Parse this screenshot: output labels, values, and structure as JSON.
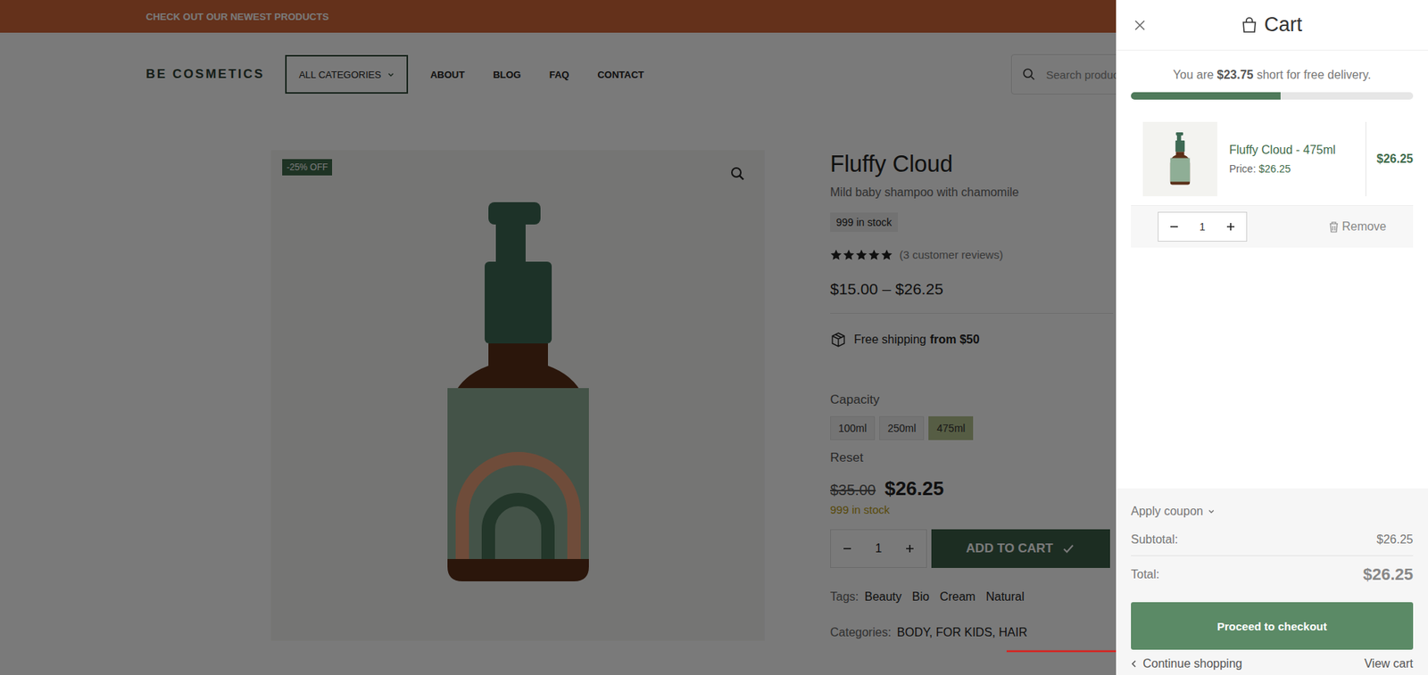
{
  "announcement": "CHECK OUT OUR NEWEST PRODUCTS",
  "header": {
    "logo": "BE COSMETICS",
    "categories_button": "ALL CATEGORIES",
    "nav": [
      "ABOUT",
      "BLOG",
      "FAQ",
      "CONTACT"
    ],
    "search_placeholder": "Search products..."
  },
  "product": {
    "badge": "-25% OFF",
    "title": "Fluffy Cloud",
    "subtitle": "Mild baby shampoo with chamomile",
    "stock_badge": "999 in stock",
    "stars": 5,
    "reviews": "(3 customer reviews)",
    "price_range": "$15.00 – $26.25",
    "shipping_text": "Free shipping",
    "shipping_bold": "from $50",
    "capacity_label": "Capacity",
    "capacities": [
      {
        "label": "100ml",
        "selected": false
      },
      {
        "label": "250ml",
        "selected": false
      },
      {
        "label": "475ml",
        "selected": true
      }
    ],
    "reset": "Reset",
    "old_price": "$35.00",
    "price": "$26.25",
    "stock": "999 in stock",
    "quantity": "1",
    "add_to_cart": "ADD TO CART",
    "tags_label": "Tags:",
    "tags": [
      "Beauty",
      "Bio",
      "Cream",
      "Natural"
    ],
    "categories_label": "Categories:",
    "categories": "BODY, FOR KIDS, HAIR"
  },
  "cart": {
    "title": "Cart",
    "delivery_prefix": "You are ",
    "delivery_amount": "$23.75",
    "delivery_suffix": " short for free delivery.",
    "delivery_level": 0.53,
    "items": [
      {
        "name": "Fluffy Cloud - 475ml",
        "price_label": "Price:",
        "price": "$26.25",
        "total": "$26.25",
        "quantity": "1"
      }
    ],
    "remove": "Remove",
    "coupon": "Apply coupon",
    "subtotal_label": "Subtotal:",
    "subtotal": "$26.25",
    "total_label": "Total:",
    "total": "$26.25",
    "checkout": "Proceed to checkout",
    "continue": "Continue shopping",
    "view_cart": "View cart"
  }
}
